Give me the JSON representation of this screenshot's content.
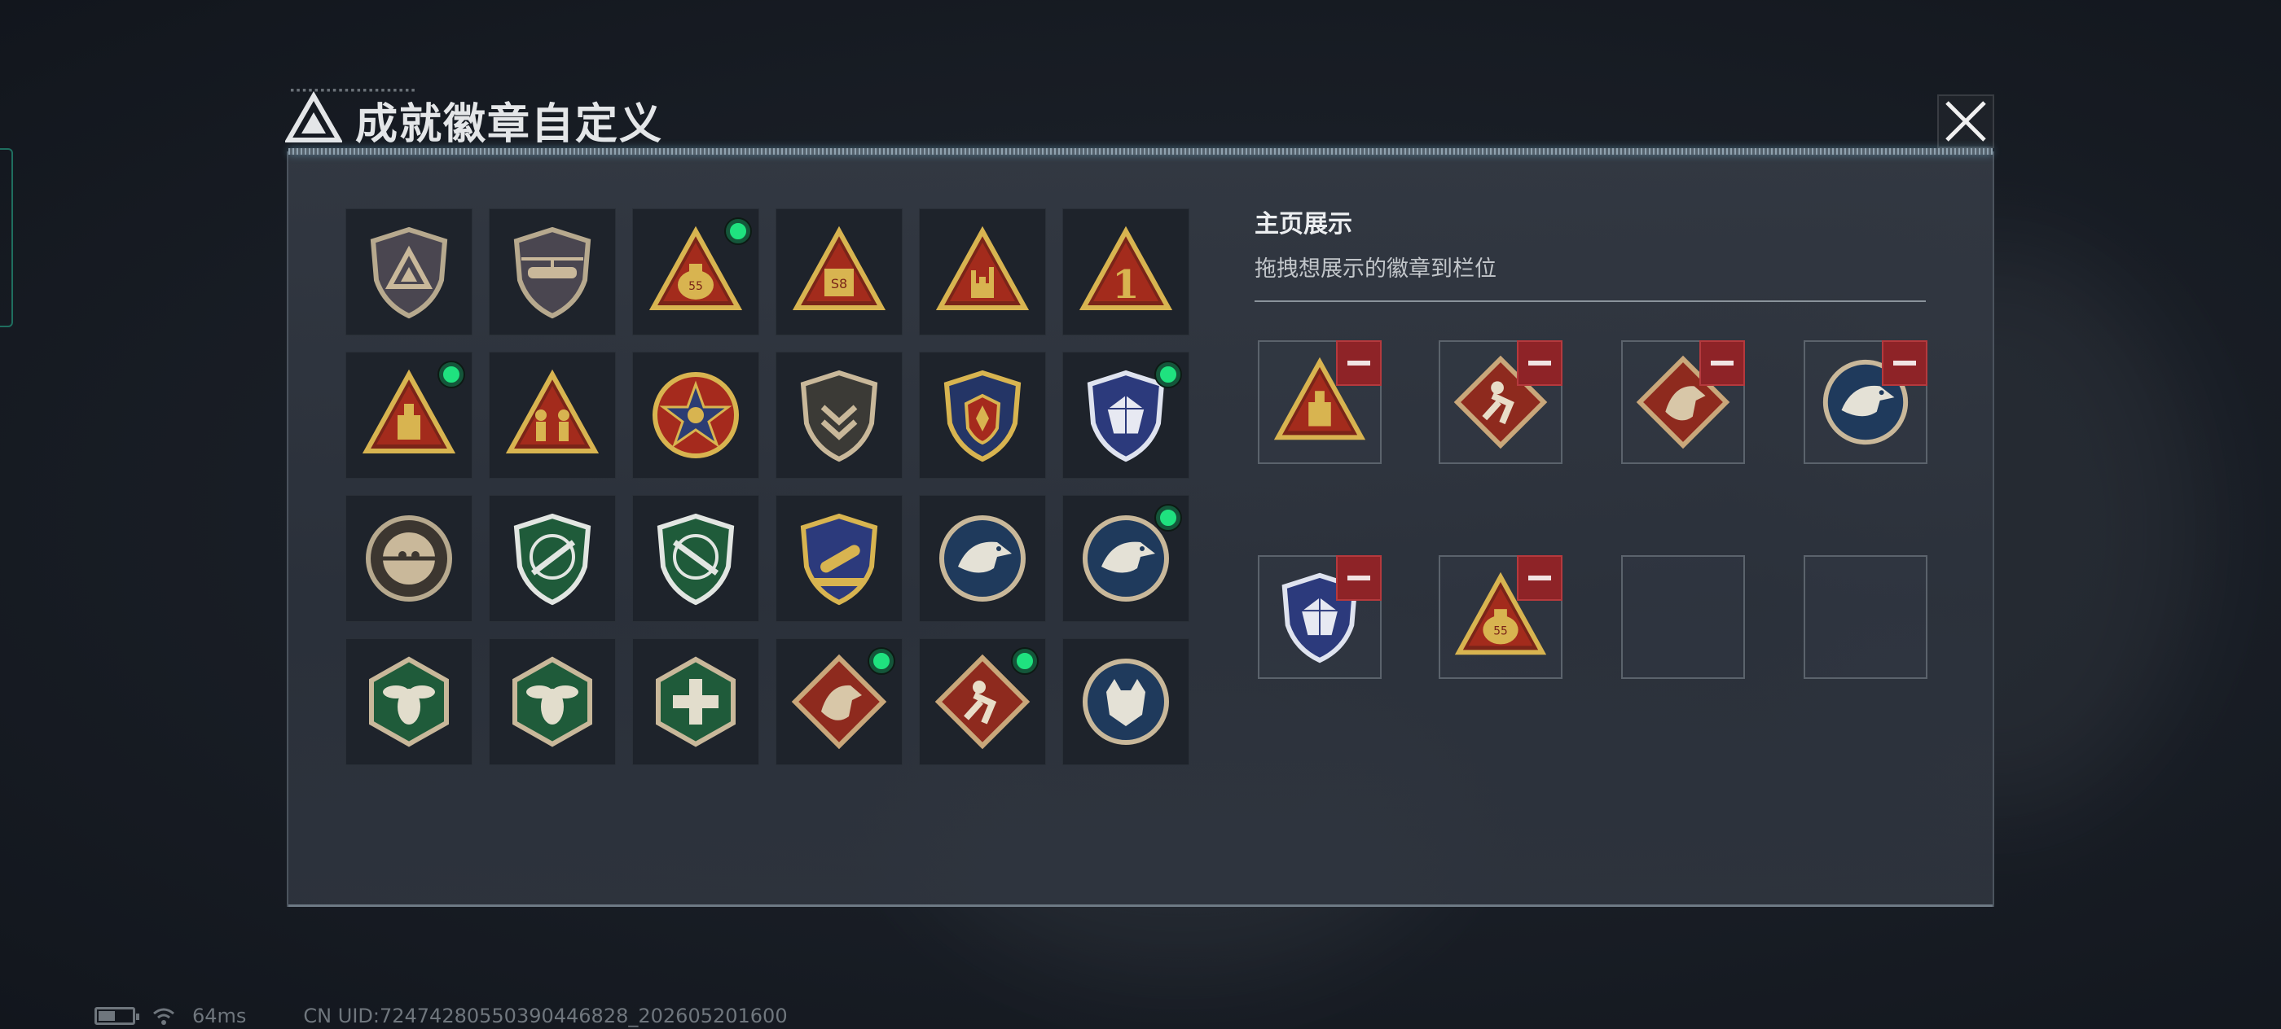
{
  "dialog": {
    "title": "成就徽章自定义",
    "title_icon": "triangle-logo-icon",
    "close_icon": "close-icon"
  },
  "colors": {
    "accent_green": "#1fe27f",
    "remove_red": "#8e2327",
    "panel": "#343a44"
  },
  "display": {
    "heading": "主页展示",
    "instruction": "拖拽想展示的徽章到栏位",
    "slots": [
      {
        "badge": "triangle-beacon-badge",
        "filled": true
      },
      {
        "badge": "red-diamond-runner-badge",
        "filled": true
      },
      {
        "badge": "red-diamond-dragon-badge",
        "filled": true
      },
      {
        "badge": "blue-eagle-badge",
        "filled": true
      },
      {
        "badge": "blue-crystal-shield-badge",
        "filled": true
      },
      {
        "badge": "triangle-moneybag-badge",
        "filled": true
      },
      {
        "badge": "",
        "filled": false
      },
      {
        "badge": "",
        "filled": false
      }
    ]
  },
  "badges": [
    {
      "name": "gray-shield-logo-badge",
      "new": false
    },
    {
      "name": "helicopter-shield-badge",
      "new": false
    },
    {
      "name": "triangle-moneybag-badge",
      "new": true
    },
    {
      "name": "triangle-s8-badge",
      "new": false
    },
    {
      "name": "triangle-horns-hand-badge",
      "new": false
    },
    {
      "name": "triangle-number-one-badge",
      "new": false
    },
    {
      "name": "triangle-beacon-badge",
      "new": true
    },
    {
      "name": "triangle-soldiers-badge",
      "new": false
    },
    {
      "name": "red-star-medal-badge",
      "new": false
    },
    {
      "name": "chevron-shield-badge",
      "new": false
    },
    {
      "name": "gold-crest-badge",
      "new": false
    },
    {
      "name": "blue-crystal-shield-badge",
      "new": true
    },
    {
      "name": "crosshair-skull-badge",
      "new": false
    },
    {
      "name": "green-rifle-shield-badge",
      "new": false
    },
    {
      "name": "green-rifle-shield-alt-badge",
      "new": false
    },
    {
      "name": "gold-missile-shield-badge",
      "new": false
    },
    {
      "name": "blue-eagle-badge",
      "new": false
    },
    {
      "name": "blue-eagle-alt-badge",
      "new": true
    },
    {
      "name": "green-hex-wasp-badge",
      "new": false
    },
    {
      "name": "green-hex-wasp-alt-badge",
      "new": false
    },
    {
      "name": "green-hex-medic-badge",
      "new": false
    },
    {
      "name": "red-diamond-dragon-badge",
      "new": true
    },
    {
      "name": "red-diamond-runner-badge",
      "new": true
    },
    {
      "name": "blue-wolf-badge",
      "new": false
    }
  ],
  "status": {
    "ping": "64ms",
    "uid": "CN UID:7247428055039044682​8_202605201600"
  }
}
